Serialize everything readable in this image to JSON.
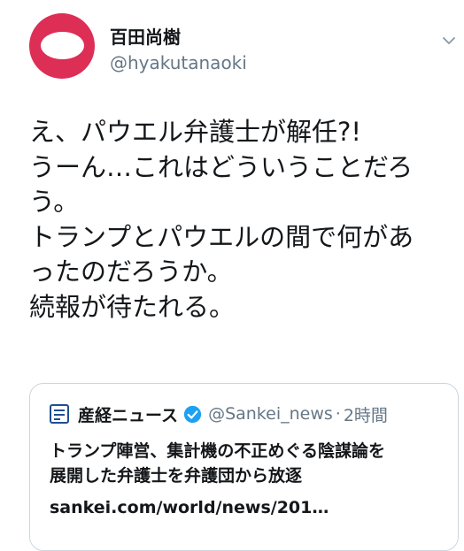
{
  "tweet": {
    "author": {
      "display_name": "百田尚樹",
      "handle": "@hyakutanaoki",
      "avatar_color": "#dd2e56"
    },
    "text_lines": [
      "え、パウエル弁護士が解任?!",
      "うーん…これはどういうことだろ",
      "う。",
      "トランプとパウエルの間で何があ",
      "ったのだろうか。",
      "続報が待たれる。"
    ]
  },
  "quote": {
    "name": "産経ニュース",
    "verified": true,
    "handle": "@Sankei_news",
    "separator": "·",
    "time": "2時間",
    "body_lines": [
      "トランプ陣営、集計機の不正めぐる陰謀論を",
      "展開した弁護士を弁護団から放逐"
    ],
    "link": "sankei.com/world/news/201…"
  },
  "colors": {
    "text": "#14171a",
    "secondary_text": "#657786",
    "border": "#ccd6dd",
    "verified_blue": "#1da1f2"
  }
}
